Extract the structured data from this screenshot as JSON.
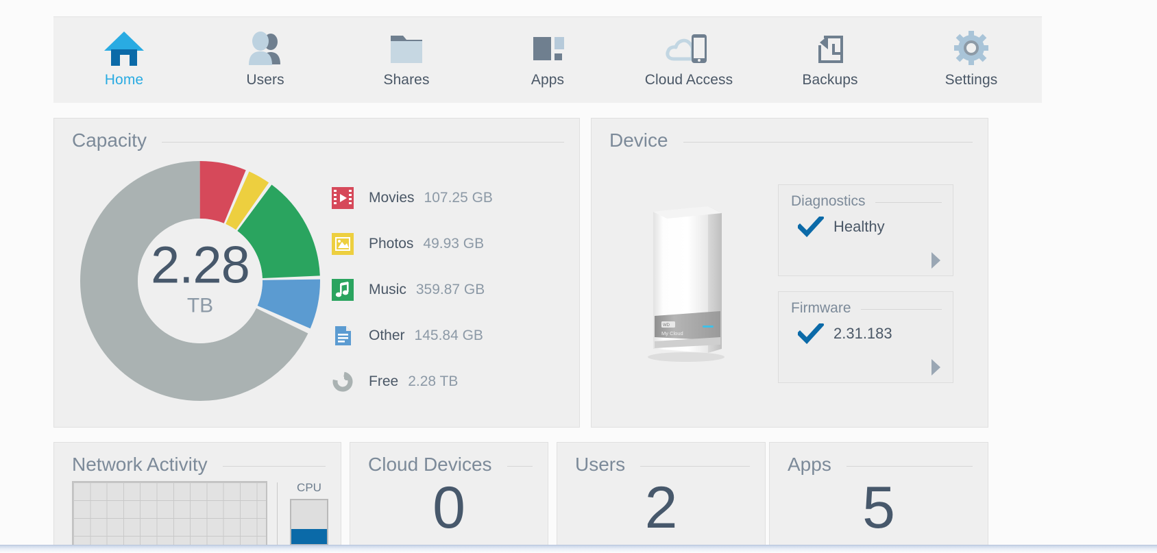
{
  "nav": {
    "items": [
      {
        "label": "Home",
        "icon": "home-icon",
        "active": true
      },
      {
        "label": "Users",
        "icon": "users-icon",
        "active": false
      },
      {
        "label": "Shares",
        "icon": "folder-icon",
        "active": false
      },
      {
        "label": "Apps",
        "icon": "apps-grid-icon",
        "active": false
      },
      {
        "label": "Cloud Access",
        "icon": "cloud-phone-icon",
        "active": false
      },
      {
        "label": "Backups",
        "icon": "backup-clock-icon",
        "active": false
      },
      {
        "label": "Settings",
        "icon": "gear-icon",
        "active": false
      }
    ],
    "active_color": "#29abe2"
  },
  "capacity": {
    "title": "Capacity",
    "center_value": "2.28",
    "center_unit": "TB",
    "legend": [
      {
        "name": "Movies",
        "value": "107.25 GB",
        "icon": "film-icon",
        "color": "#d6495a"
      },
      {
        "name": "Photos",
        "value": "49.93 GB",
        "icon": "picture-icon",
        "color": "#edcf3f"
      },
      {
        "name": "Music",
        "value": "359.87 GB",
        "icon": "music-icon",
        "color": "#2aa45f"
      },
      {
        "name": "Other",
        "value": "145.84 GB",
        "icon": "document-icon",
        "color": "#5b9bd1"
      },
      {
        "name": "Free",
        "value": "2.28 TB",
        "icon": "donut-icon",
        "color": "#aab2b2"
      }
    ]
  },
  "chart_data": {
    "type": "pie",
    "title": "Capacity",
    "labels": [
      "Movies",
      "Photos",
      "Music",
      "Other",
      "Free"
    ],
    "values": [
      107.25,
      49.93,
      359.87,
      145.84,
      2280
    ],
    "units": "GB",
    "colors": [
      "#d6495a",
      "#edcf3f",
      "#2aa45f",
      "#5b9bd1",
      "#aab2b2"
    ],
    "center_label": "2.28 TB",
    "legend_position": "right",
    "donut": true
  },
  "device": {
    "title": "Device",
    "image_name": "wd-my-cloud-nas",
    "image_brand": "WD",
    "image_model": "My Cloud",
    "diagnostics": {
      "title": "Diagnostics",
      "status": "Healthy",
      "icon": "check-icon",
      "arrow": "chevron-right-icon"
    },
    "firmware": {
      "title": "Firmware",
      "status": "2.31.183",
      "icon": "check-icon",
      "arrow": "chevron-right-icon"
    },
    "status_color": "#0b6aa8"
  },
  "bottom": {
    "network": {
      "title": "Network Activity",
      "cpu_label": "CPU",
      "cpu_percent": 32
    },
    "cloud_devices": {
      "title": "Cloud Devices",
      "value": "0"
    },
    "users": {
      "title": "Users",
      "value": "2"
    },
    "apps": {
      "title": "Apps",
      "value": "5"
    }
  }
}
